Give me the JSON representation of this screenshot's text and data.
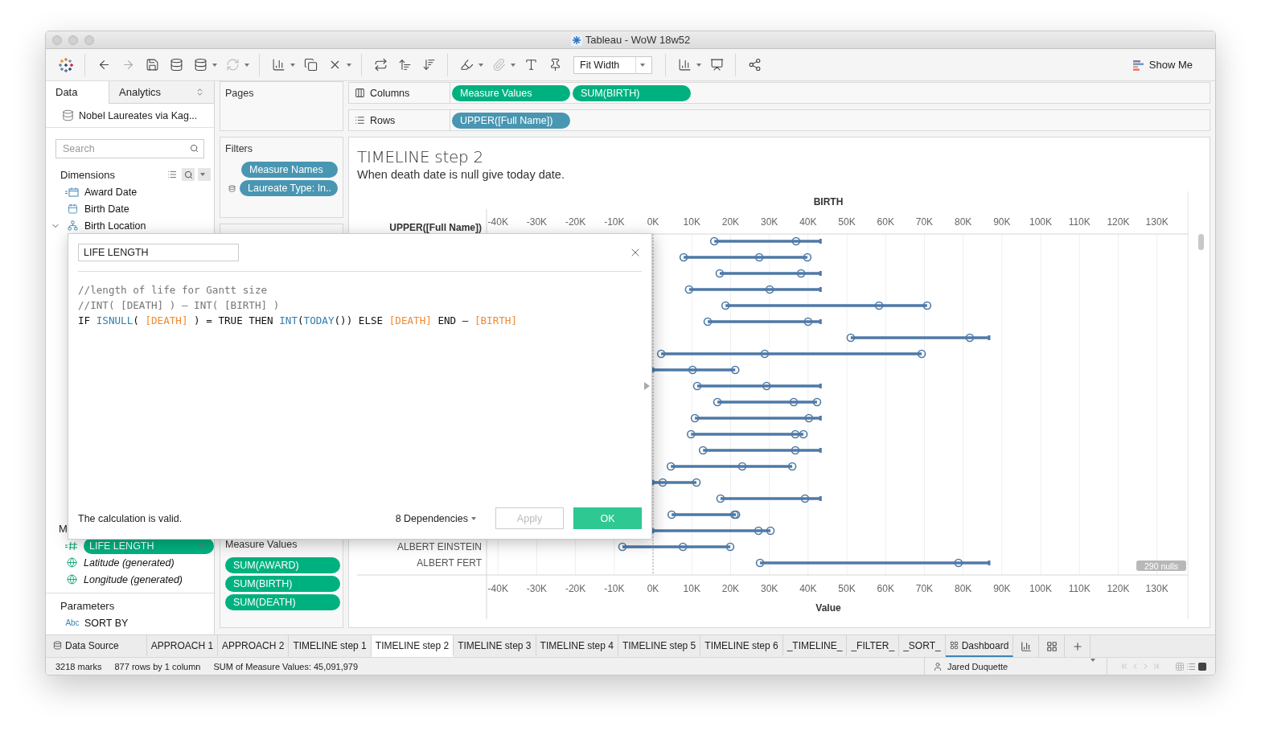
{
  "window": {
    "title": "Tableau - WoW 18w52"
  },
  "toolbar": {
    "fit": "Fit Width",
    "show_me": "Show Me"
  },
  "data_pane": {
    "tabs": [
      {
        "label": "Data",
        "selected": true
      },
      {
        "label": "Analytics",
        "selected": false
      }
    ],
    "datasource": "Nobel Laureates via Kag...",
    "search": {
      "placeholder": "Search"
    },
    "dimensions": {
      "title": "Dimensions",
      "items": [
        {
          "kind": "calculated-date",
          "label": "Award Date",
          "expanded": false
        },
        {
          "kind": "date",
          "label": "Birth Date",
          "expanded": false
        },
        {
          "kind": "hierarchy",
          "label": "Birth Location",
          "expanded": true
        }
      ]
    },
    "measures_header": "M",
    "measures": [
      {
        "kind": "calculated-measure",
        "label": "LIFE LENGTH",
        "selected": true,
        "generated": false
      },
      {
        "kind": "geo",
        "label": "Latitude (generated)",
        "selected": false,
        "generated": true
      },
      {
        "kind": "geo",
        "label": "Longitude (generated)",
        "selected": false,
        "generated": true
      }
    ],
    "parameters": {
      "title": "Parameters",
      "items": [
        {
          "type_label": "Abc",
          "label": "SORT BY"
        }
      ]
    }
  },
  "cards": {
    "pages": {
      "title": "Pages"
    },
    "filters": {
      "title": "Filters",
      "pills": [
        {
          "label": "Measure Names",
          "kind": "dimension",
          "datasource_icon": false
        },
        {
          "label": "Laureate Type: In..",
          "kind": "dimension",
          "datasource_icon": true
        }
      ]
    },
    "measure_values": {
      "title": "Measure Values",
      "pills": [
        {
          "label": "SUM(AWARD)",
          "kind": "measure"
        },
        {
          "label": "SUM(BIRTH)",
          "kind": "measure"
        },
        {
          "label": "SUM(DEATH)",
          "kind": "measure"
        }
      ]
    }
  },
  "shelves": [
    {
      "kind": "columns",
      "label": "Columns",
      "pills": [
        {
          "label": "Measure Values",
          "kind": "measure"
        },
        {
          "label": "SUM(BIRTH)",
          "kind": "measure"
        }
      ]
    },
    {
      "kind": "rows",
      "label": "Rows",
      "pills": [
        {
          "label": "UPPER([Full Name])",
          "kind": "dimension"
        }
      ]
    }
  ],
  "view": {
    "title": "TIMELINE step 2",
    "subtitle": "When death date is null give today date.",
    "nulls": "290 nulls",
    "chart_data": {
      "type": "scatter",
      "orientation": "horizontal",
      "title": "BIRTH",
      "ylabel": "UPPER([Full Name])",
      "xlabel": "Value",
      "xlim": [
        -42000,
        138000
      ],
      "xticks": [
        {
          "value": -40000,
          "label": "-40K"
        },
        {
          "value": -30000,
          "label": "-30K"
        },
        {
          "value": -20000,
          "label": "-20K"
        },
        {
          "value": -10000,
          "label": "-10K"
        },
        {
          "value": 0,
          "label": "0K"
        },
        {
          "value": 10000,
          "label": "10K"
        },
        {
          "value": 20000,
          "label": "20K"
        },
        {
          "value": 30000,
          "label": "30K"
        },
        {
          "value": 40000,
          "label": "40K"
        },
        {
          "value": 50000,
          "label": "50K"
        },
        {
          "value": 60000,
          "label": "60K"
        },
        {
          "value": 70000,
          "label": "70K"
        },
        {
          "value": 80000,
          "label": "80K"
        },
        {
          "value": 90000,
          "label": "90K"
        },
        {
          "value": 100000,
          "label": "100K"
        },
        {
          "value": 110000,
          "label": "110K"
        },
        {
          "value": 120000,
          "label": "120K"
        },
        {
          "value": 130000,
          "label": "130K"
        }
      ],
      "categories": [
        null,
        null,
        null,
        null,
        null,
        null,
        null,
        null,
        null,
        null,
        null,
        null,
        null,
        null,
        null,
        null,
        null,
        null,
        null,
        "ALBERT EINSTEIN",
        "ALBERT FERT"
      ],
      "series": [
        {
          "color": "#4e79a7",
          "values": [
            15800,
            7900,
            17200,
            9300,
            18700,
            14100,
            51000,
            2100,
            10200,
            11400,
            16600,
            10800,
            9800,
            12900,
            4600,
            2500,
            17400,
            4800,
            27200,
            -7900,
            27600
          ]
        },
        {
          "color": "#4e79a7",
          "values": [
            36900,
            27400,
            38200,
            30100,
            58300,
            40000,
            81700,
            28800,
            21200,
            29300,
            36300,
            40200,
            36700,
            36700,
            23000,
            11200,
            39200,
            21000,
            30300,
            7700,
            78800
          ]
        },
        {
          "color": "#4e79a7",
          "values": [
            null,
            39800,
            null,
            null,
            70700,
            null,
            null,
            69300,
            null,
            null,
            42300,
            null,
            38800,
            null,
            35900,
            null,
            null,
            21400,
            null,
            19900,
            null
          ]
        },
        {
          "color": "#4e79a7",
          "values": [
            43200,
            null,
            43200,
            43200,
            null,
            43200,
            86700,
            null,
            0,
            43200,
            null,
            43200,
            null,
            43200,
            null,
            0,
            43200,
            null,
            0,
            null,
            86700
          ]
        }
      ],
      "grid": true,
      "ref_lines": [
        {
          "axis": "x",
          "value": 0
        }
      ]
    }
  },
  "dialog": {
    "name": "LIFE LENGTH",
    "code": [
      [
        {
          "kind": "comment",
          "text": "//length of life for Gantt size"
        }
      ],
      [
        {
          "kind": "comment",
          "text": "//INT( [DEATH] ) – INT( [BIRTH] )"
        }
      ],
      [
        {
          "kind": "keyword",
          "text": "IF "
        },
        {
          "kind": "function",
          "text": "ISNULL"
        },
        {
          "kind": "plain",
          "text": "( "
        },
        {
          "kind": "field",
          "text": "[DEATH]"
        },
        {
          "kind": "plain",
          "text": " ) = "
        },
        {
          "kind": "keyword",
          "text": "TRUE THEN "
        },
        {
          "kind": "function",
          "text": "INT"
        },
        {
          "kind": "plain",
          "text": "("
        },
        {
          "kind": "function",
          "text": "TODAY"
        },
        {
          "kind": "plain",
          "text": "()) "
        },
        {
          "kind": "keyword",
          "text": "ELSE "
        },
        {
          "kind": "field",
          "text": "[DEATH]"
        },
        {
          "kind": "keyword",
          "text": " END"
        },
        {
          "kind": "plain",
          "text": " – "
        },
        {
          "kind": "field",
          "text": "[BIRTH]"
        }
      ]
    ],
    "status": "The calculation is valid.",
    "dependencies": "8 Dependencies",
    "buttons": [
      {
        "label": "Apply",
        "kind": "secondary",
        "disabled": true
      },
      {
        "label": "OK",
        "kind": "primary",
        "disabled": false
      }
    ]
  },
  "sheet_tabs": [
    {
      "label": "Data Source",
      "kind": "datasource",
      "selected": false
    },
    {
      "label": "APPROACH 1",
      "kind": "sheet",
      "selected": false
    },
    {
      "label": "APPROACH 2",
      "kind": "sheet",
      "selected": false
    },
    {
      "label": "TIMELINE step 1",
      "kind": "sheet",
      "selected": false
    },
    {
      "label": "TIMELINE step 2",
      "kind": "sheet",
      "selected": true
    },
    {
      "label": "TIMELINE step 3",
      "kind": "sheet",
      "selected": false
    },
    {
      "label": "TIMELINE step 4",
      "kind": "sheet",
      "selected": false
    },
    {
      "label": "TIMELINE step 5",
      "kind": "sheet",
      "selected": false
    },
    {
      "label": "TIMELINE step 6",
      "kind": "sheet",
      "selected": false
    },
    {
      "label": "_TIMELINE_",
      "kind": "sheet",
      "selected": false
    },
    {
      "label": "_FILTER_",
      "kind": "sheet",
      "selected": false
    },
    {
      "label": "_SORT_",
      "kind": "sheet",
      "selected": false
    },
    {
      "label": "Dashboard",
      "kind": "dashboard",
      "selected": false
    }
  ],
  "status_bar": {
    "marks": "3218 marks",
    "rows": "877 rows by 1 column",
    "sum": "SUM of Measure Values: 45,091,979",
    "user": "Jared Duquette"
  }
}
